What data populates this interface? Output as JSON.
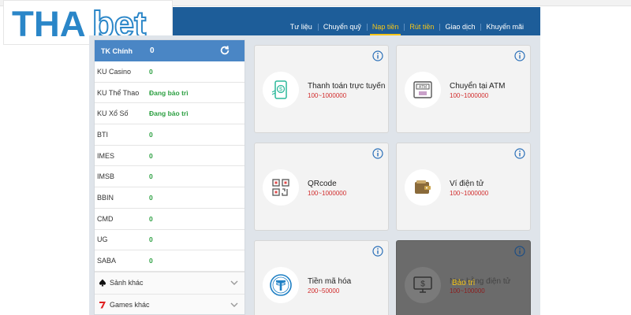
{
  "brand": {
    "logo_text_part1": "THA",
    "logo_text_part2": "bet"
  },
  "nav": {
    "items": [
      {
        "label": "Tư liệu"
      },
      {
        "label": "Chuyển quỹ"
      },
      {
        "label": "Nạp tiền"
      },
      {
        "label": "Rút tiền"
      },
      {
        "label": "Giao dịch"
      },
      {
        "label": "Khuyến mãi"
      }
    ]
  },
  "sidebar": {
    "main": {
      "label": "TK Chính",
      "value": "0"
    },
    "rows": [
      {
        "label": "KU Casino",
        "value": "0"
      },
      {
        "label": "KU Thể Thao",
        "value": "Đang bảo trì"
      },
      {
        "label": "KU Xổ Số",
        "value": "Đang bảo trì"
      },
      {
        "label": "BTI",
        "value": "0"
      },
      {
        "label": "IMES",
        "value": "0"
      },
      {
        "label": "IMSB",
        "value": "0"
      },
      {
        "label": "BBIN",
        "value": "0"
      },
      {
        "label": "CMD",
        "value": "0"
      },
      {
        "label": "UG",
        "value": "0"
      },
      {
        "label": "SABA",
        "value": "0"
      }
    ],
    "more_halls": "Sảnh khác",
    "more_games": "Games khác"
  },
  "methods": [
    {
      "title": "Thanh toán trực tuyến",
      "range": "100~1000000",
      "icon": "mobile-payment-icon"
    },
    {
      "title": "Chuyển tại ATM",
      "range": "100~1000000",
      "icon": "atm-icon"
    },
    {
      "title": "QRcode",
      "range": "100~1000000",
      "icon": "qrcode-icon"
    },
    {
      "title": "Ví điện tử",
      "range": "100~1000000",
      "icon": "wallet-icon"
    },
    {
      "title": "Tiền mã hóa",
      "range": "200~50000",
      "icon": "crypto-icon"
    },
    {
      "title": "Nạp bằng điện tử",
      "range": "100~100000",
      "icon": "monitor-payment-icon",
      "status": "Bảo trì"
    }
  ],
  "colors": {
    "nav_bg": "#1d5d99",
    "active": "#f5c518",
    "value_green": "#2ea043",
    "range_red": "#d12c2c",
    "sidebar_header": "#4a86c5"
  }
}
